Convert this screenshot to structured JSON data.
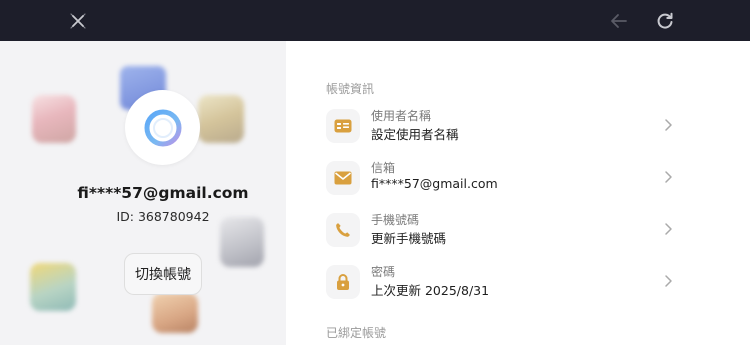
{
  "colors": {
    "topbar": "#1d1e2a",
    "accent": "#d9a03f",
    "left_panel_bg": "#f3f3f5"
  },
  "topbar": {
    "close_icon": "close-x-icon",
    "back_icon": "arrow-left-icon",
    "refresh_icon": "refresh-icon"
  },
  "profile": {
    "email": "fi****57@gmail.com",
    "id_text": "ID: 368780942",
    "switch_label": "切換帳號",
    "avatar_icon": "ring-logo-icon"
  },
  "account_info": {
    "section_title": "帳號資訊",
    "rows": [
      {
        "icon": "id-card-icon",
        "label": "使用者名稱",
        "value": "設定使用者名稱"
      },
      {
        "icon": "mail-icon",
        "label": "信箱",
        "value": "fi****57@gmail.com"
      },
      {
        "icon": "phone-icon",
        "label": "手機號碼",
        "value": "更新手機號碼"
      },
      {
        "icon": "lock-icon",
        "label": "密碼",
        "value": "上次更新 2025/8/31"
      }
    ]
  },
  "bound_accounts": {
    "section_title": "已綁定帳號"
  }
}
